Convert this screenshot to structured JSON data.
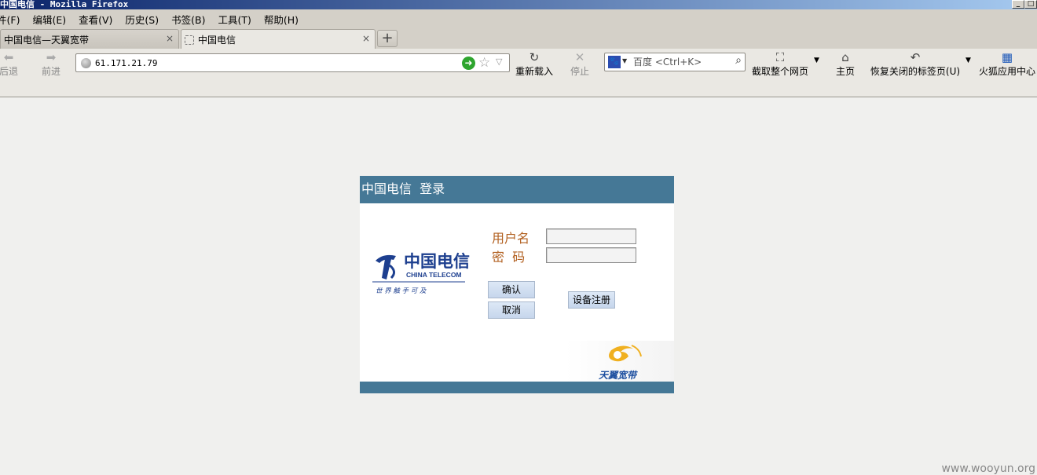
{
  "window": {
    "title": "中国电信 - Mozilla Firefox",
    "controls": [
      "_",
      "□"
    ]
  },
  "menu": [
    "件(F)",
    "编辑(E)",
    "查看(V)",
    "历史(S)",
    "书签(B)",
    "工具(T)",
    "帮助(H)"
  ],
  "tabs": [
    {
      "label": "中国电信—天翼宽带",
      "close": "×"
    },
    {
      "label": "中国电信",
      "close": "×"
    }
  ],
  "newtab_label": "+",
  "toolbar": {
    "back": "后退",
    "forward": "前进",
    "reload": "重新载入",
    "stop": "停止",
    "screenshot": "截取整个网页",
    "home": "主页",
    "restore_tabs": "恢复关闭的标签页(U)",
    "app_center": "火狐应用中心"
  },
  "url": {
    "value": "61.171.21.79"
  },
  "search": {
    "placeholder": "百度 <Ctrl+K>"
  },
  "login": {
    "header": "中国电信  登录",
    "username_label": "用户名",
    "password_label": "密  码",
    "confirm": "确认",
    "cancel": "取消",
    "register": "设备注册",
    "logo_text": "中国电信",
    "logo_en": "CHINA TELECOM",
    "logo_slogan": "世 界 触 手 可 及",
    "brand_text": "天翼宽带"
  },
  "watermark": "www.wooyun.org",
  "colors": {
    "header": "#457896",
    "label": "#b26020",
    "logo": "#1d3f8f"
  }
}
